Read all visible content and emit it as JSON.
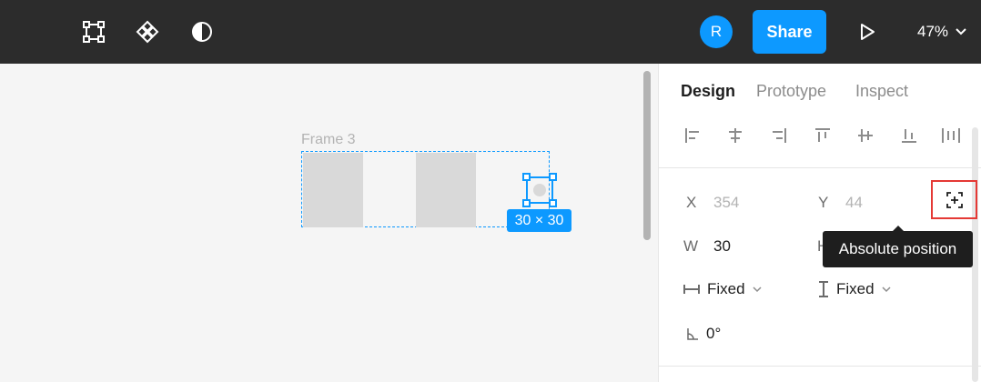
{
  "toolbar": {
    "icons": [
      "frame-icon",
      "component-icon",
      "contrast-icon"
    ],
    "avatar_initial": "R",
    "share_label": "Share",
    "zoom_label": "47%"
  },
  "canvas": {
    "frame_label": "Frame 3",
    "size_badge": "30 × 30"
  },
  "panel": {
    "tabs": [
      {
        "label": "Design",
        "active": true
      },
      {
        "label": "Prototype",
        "active": false
      },
      {
        "label": "Inspect",
        "active": false
      }
    ],
    "position": {
      "x_label": "X",
      "x_value": "354",
      "y_label": "Y",
      "y_value": "44"
    },
    "size": {
      "w_label": "W",
      "w_value": "30",
      "h_label": "H"
    },
    "resizing": {
      "horizontal": "Fixed",
      "vertical": "Fixed"
    },
    "rotation": "0°",
    "tooltip": "Absolute position"
  },
  "colors": {
    "accent": "#0d99ff",
    "toolbar_bg": "#2c2c2c",
    "highlight": "#e53935"
  }
}
